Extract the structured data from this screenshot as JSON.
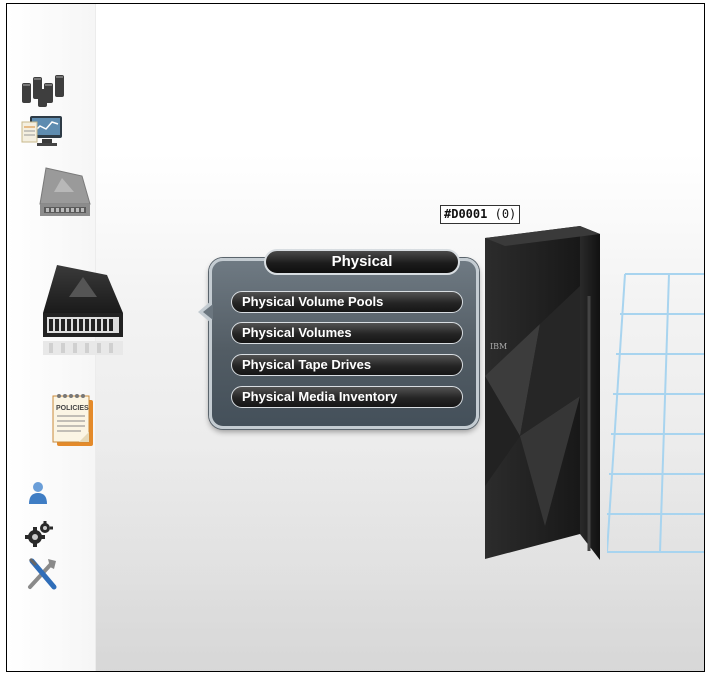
{
  "device": {
    "id": "#D0001",
    "count": "(0)",
    "brand": "IBM"
  },
  "popup": {
    "title": "Physical",
    "items": [
      {
        "label": "Physical Volume Pools"
      },
      {
        "label": "Physical Volumes"
      },
      {
        "label": "Physical Tape Drives"
      },
      {
        "label": "Physical Media Inventory"
      }
    ]
  },
  "sidebar": {
    "icons": [
      {
        "name": "servers-icon"
      },
      {
        "name": "monitor-chart-icon"
      },
      {
        "name": "virtual-drive-icon"
      },
      {
        "name": "physical-tape-library-icon"
      },
      {
        "name": "policies-icon",
        "label": "POLICIES"
      },
      {
        "name": "user-icon"
      },
      {
        "name": "settings-gears-icon"
      },
      {
        "name": "tools-icon"
      }
    ]
  },
  "colors": {
    "popup_body": "#5a646c",
    "popup_border": "#c4ccd2",
    "menu_pill": "#1e1e1e",
    "grid_line": "#a8d4ef"
  }
}
